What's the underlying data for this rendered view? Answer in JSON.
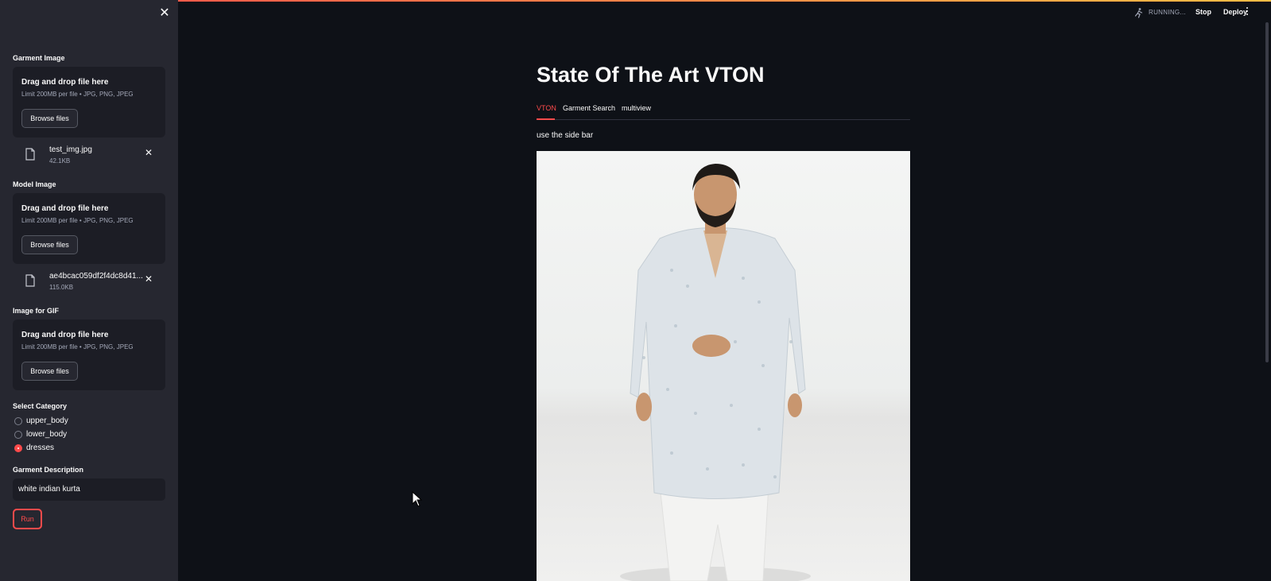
{
  "sidebar": {
    "close_icon": "close-icon",
    "uploaders": [
      {
        "label": "Garment Image",
        "drop_title": "Drag and drop file here",
        "drop_subtitle": "Limit 200MB per file • JPG, PNG, JPEG",
        "browse_label": "Browse files",
        "file": {
          "name": "test_img.jpg",
          "size": "42.1KB"
        }
      },
      {
        "label": "Model Image",
        "drop_title": "Drag and drop file here",
        "drop_subtitle": "Limit 200MB per file • JPG, PNG, JPEG",
        "browse_label": "Browse files",
        "file": {
          "name": "ae4bcac059df2f4dc8d41...",
          "size": "115.0KB"
        }
      },
      {
        "label": "Image for GIF",
        "drop_title": "Drag and drop file here",
        "drop_subtitle": "Limit 200MB per file • JPG, PNG, JPEG",
        "browse_label": "Browse files"
      }
    ],
    "category": {
      "label": "Select Category",
      "options": [
        "upper_body",
        "lower_body",
        "dresses"
      ],
      "selected": "dresses"
    },
    "description": {
      "label": "Garment Description",
      "value": "white indian kurta"
    },
    "run_label": "Run"
  },
  "header": {
    "status": "RUNNING...",
    "stop_label": "Stop",
    "deploy_label": "Deploy",
    "menu_icon": "more-vertical-icon"
  },
  "main": {
    "title": "State Of The Art VTON",
    "tabs": [
      {
        "label": "VTON",
        "active": true
      },
      {
        "label": "Garment Search",
        "active": false
      },
      {
        "label": "multiview",
        "active": false
      }
    ],
    "caption": "use the side bar"
  },
  "colors": {
    "accent": "#ff4b4b",
    "background": "#0e1117",
    "sidebar": "#262730"
  }
}
